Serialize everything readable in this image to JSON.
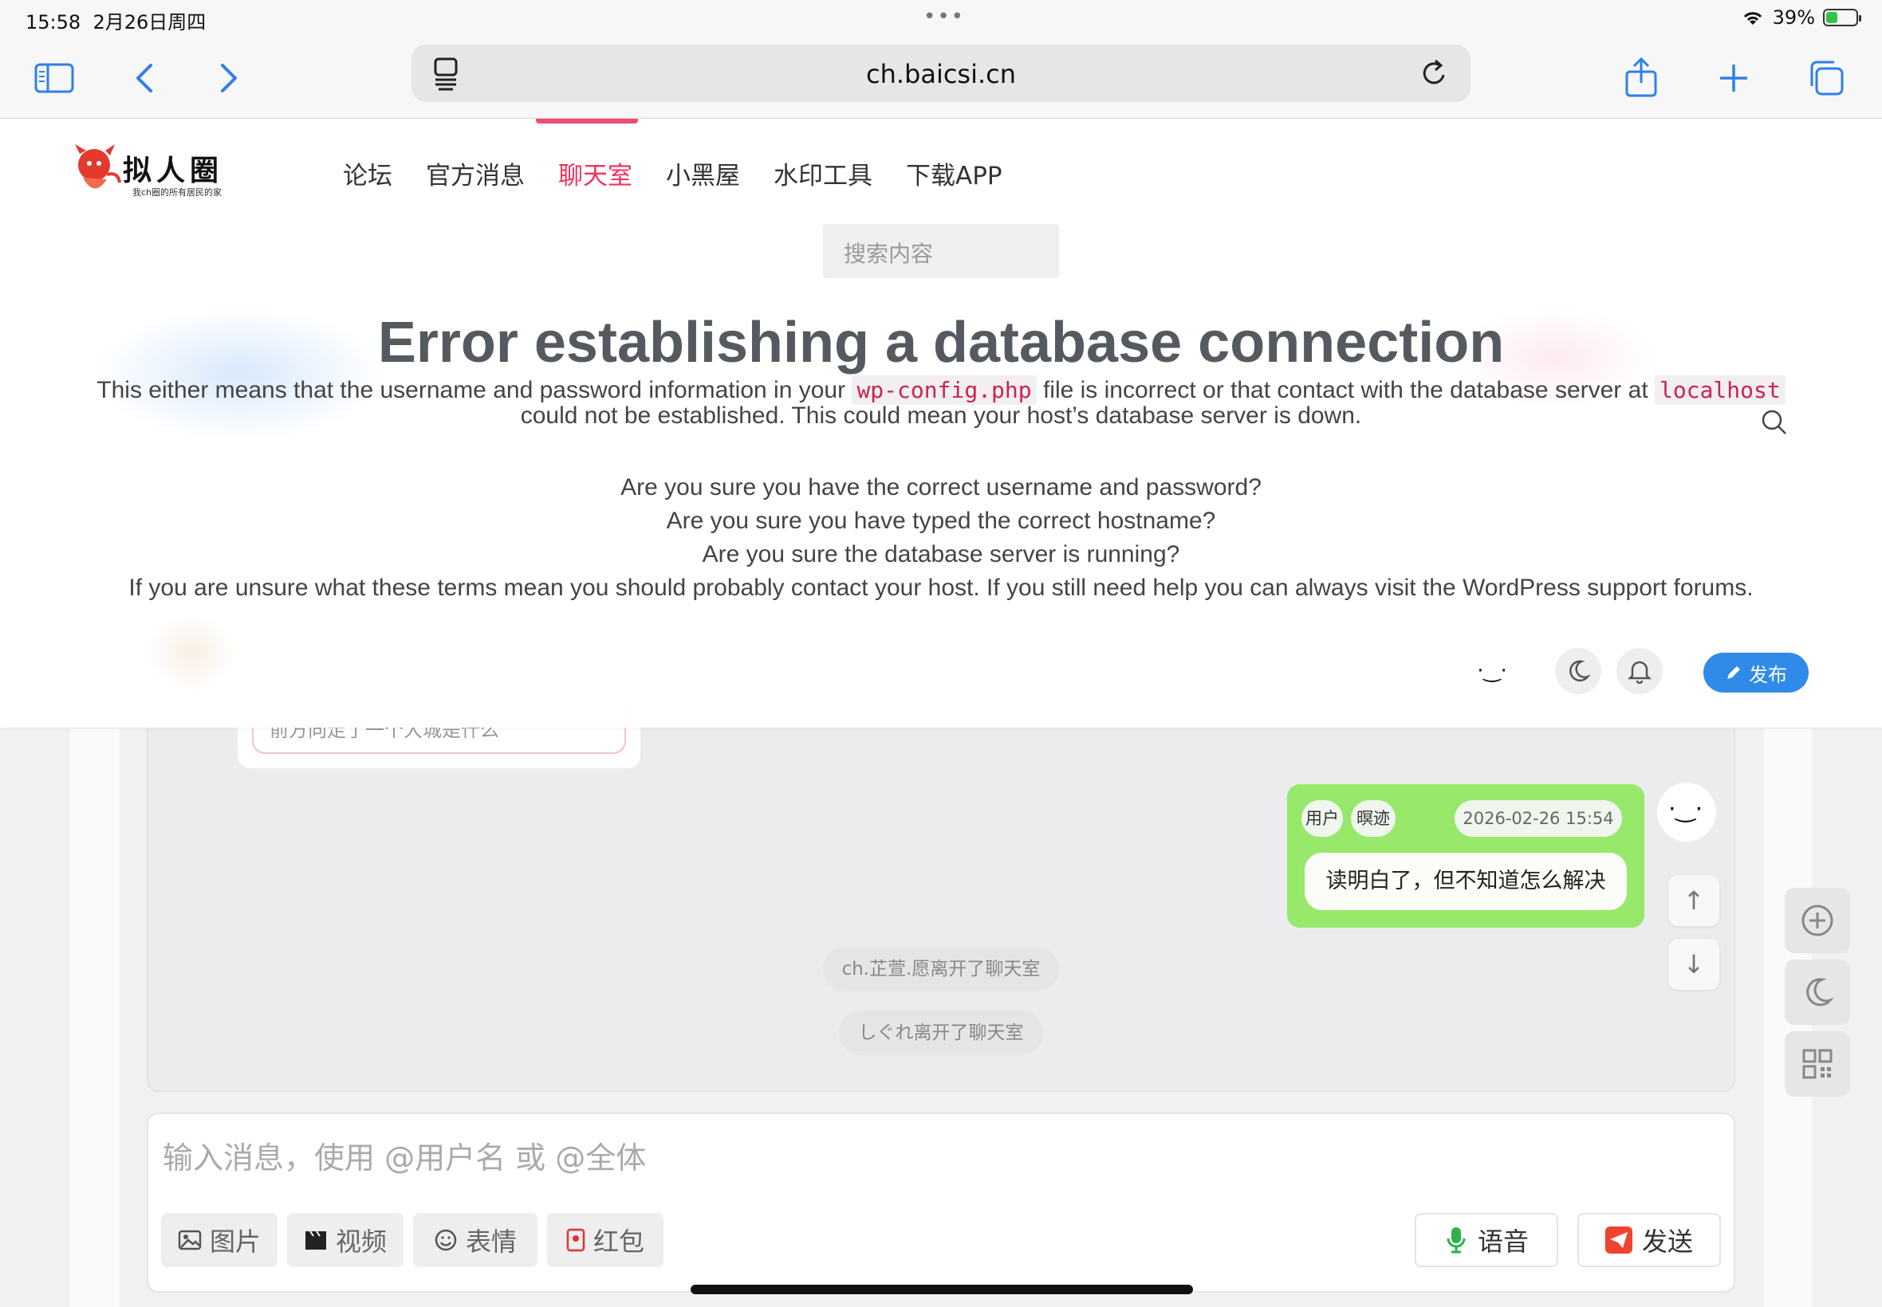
{
  "status_bar": {
    "time": "15:58",
    "date": "2月26日周四",
    "battery": "39%",
    "battery_level": 0.39
  },
  "browser": {
    "url": "ch.baicsi.cn"
  },
  "site": {
    "logo_title": "拟人圈",
    "logo_subtitle": "我ch圈的所有居民的家",
    "nav": [
      "论坛",
      "官方消息",
      "聊天室",
      "小黑屋",
      "水印工具",
      "下载APP"
    ],
    "active_nav": "聊天室",
    "search_placeholder": "搜索内容",
    "publish_label": "发布"
  },
  "error": {
    "title": "Error establishing a database connection",
    "line1_a": "This either means that the username and password information in your",
    "line1_code": "wp-config.php",
    "line1_b": "file is incorrect or that contact with the database server at",
    "line1_code2": "localhost",
    "line2": "could not be established. This could mean your host’s database server is down.",
    "q1": "Are you sure you have the correct username and password?",
    "q2": "Are you sure you have typed the correct hostname?",
    "q3": "Are you sure the database server is running?",
    "help": "If you are unsure what these terms mean you should probably contact your host. If you still need help you can always visit the WordPress support forums."
  },
  "chat": {
    "partial_message": "前方向走了一个大城是什么",
    "message": {
      "role": "用户",
      "name": "暝迹",
      "time": "2026-02-26 15:54",
      "text": "读明白了，但不知道怎么解决"
    },
    "system_messages": [
      "ch.芷萱.愿离开了聊天室",
      "しぐれ离开了聊天室"
    ],
    "input_placeholder": "输入消息，使用 @用户名 或 @全体",
    "tools": [
      "图片",
      "视频",
      "表情",
      "红包"
    ],
    "voice_label": "语音",
    "send_label": "发送",
    "face_glyph": "·‿·"
  },
  "colors": {
    "accent": "#f0325e",
    "bubble": "#97e86b",
    "publish": "#2f8ae8"
  }
}
